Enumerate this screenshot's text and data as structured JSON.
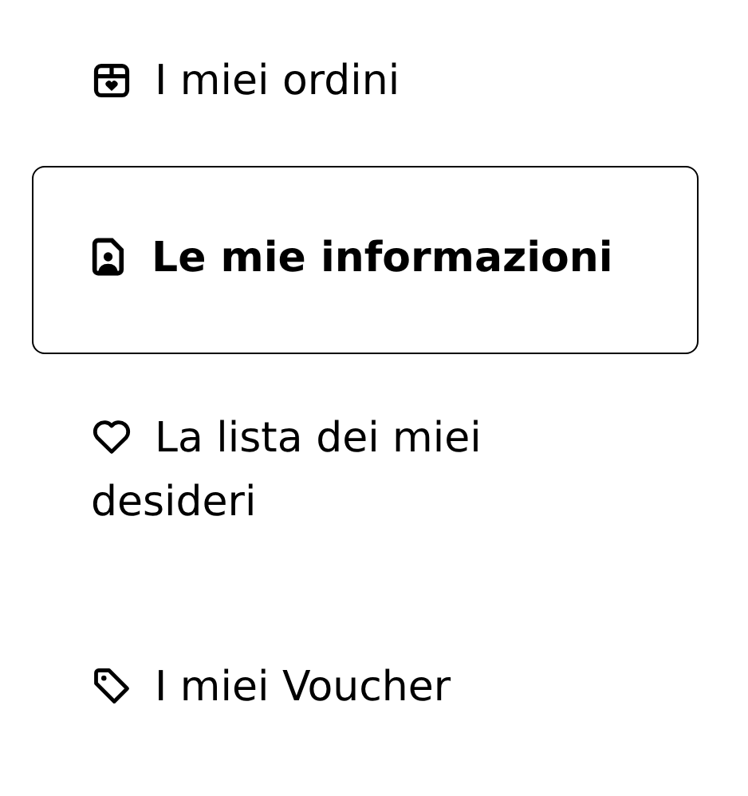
{
  "menu": [
    {
      "label": "I miei ordini",
      "selected": false
    },
    {
      "label": "Le mie informazioni",
      "selected": true
    },
    {
      "label": "La lista dei miei desideri",
      "selected": false
    },
    {
      "label": "I miei Voucher",
      "selected": false
    }
  ]
}
